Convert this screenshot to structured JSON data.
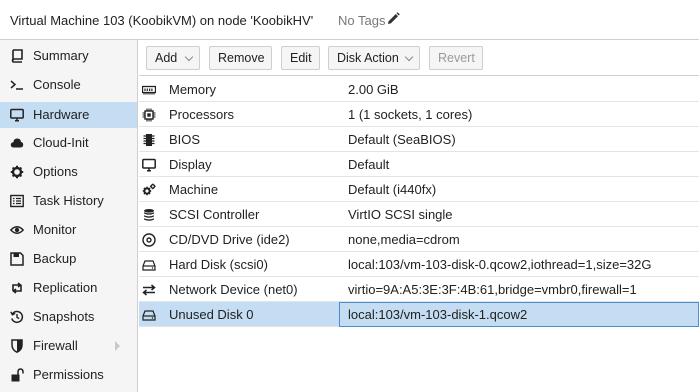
{
  "header": {
    "title": "Virtual Machine 103 (KoobikVM) on node 'KoobikHV'",
    "tags": "No Tags",
    "edit_icon": "pencil-icon"
  },
  "sidebar": {
    "items": [
      {
        "label": "Summary",
        "icon": "book-icon"
      },
      {
        "label": "Console",
        "icon": "terminal-icon"
      },
      {
        "label": "Hardware",
        "icon": "monitor-icon",
        "active": true
      },
      {
        "label": "Cloud-Init",
        "icon": "cloud-icon"
      },
      {
        "label": "Options",
        "icon": "gear-icon"
      },
      {
        "label": "Task History",
        "icon": "list-icon"
      },
      {
        "label": "Monitor",
        "icon": "eye-icon"
      },
      {
        "label": "Backup",
        "icon": "floppy-icon"
      },
      {
        "label": "Replication",
        "icon": "retweet-icon"
      },
      {
        "label": "Snapshots",
        "icon": "history-icon"
      },
      {
        "label": "Firewall",
        "icon": "shield-icon",
        "expandable": true
      },
      {
        "label": "Permissions",
        "icon": "unlock-icon"
      }
    ]
  },
  "toolbar": {
    "add": "Add",
    "remove": "Remove",
    "edit": "Edit",
    "disk_action": "Disk Action",
    "revert": "Revert"
  },
  "hardware": {
    "rows": [
      {
        "key": "Memory",
        "value": "2.00 GiB",
        "icon": "memory-icon"
      },
      {
        "key": "Processors",
        "value": "1 (1 sockets, 1 cores)",
        "icon": "cpu-icon"
      },
      {
        "key": "BIOS",
        "value": "Default (SeaBIOS)",
        "icon": "chip-icon"
      },
      {
        "key": "Display",
        "value": "Default",
        "icon": "desktop-icon"
      },
      {
        "key": "Machine",
        "value": "Default (i440fx)",
        "icon": "cogs-icon"
      },
      {
        "key": "SCSI Controller",
        "value": "VirtIO SCSI single",
        "icon": "database-icon"
      },
      {
        "key": "CD/DVD Drive (ide2)",
        "value": "none,media=cdrom",
        "icon": "cdrom-icon"
      },
      {
        "key": "Hard Disk (scsi0)",
        "value": "local:103/vm-103-disk-0.qcow2,iothread=1,size=32G",
        "icon": "hdd-icon"
      },
      {
        "key": "Network Device (net0)",
        "value": "virtio=9A:A5:3E:3F:4B:61,bridge=vmbr0,firewall=1",
        "icon": "exchange-icon"
      },
      {
        "key": "Unused Disk 0",
        "value": "local:103/vm-103-disk-1.qcow2",
        "icon": "hdd-icon",
        "selected": true
      }
    ]
  },
  "colors": {
    "selection": "#c4ddf2",
    "focus_border": "#4a8ed0",
    "sidebar_bg": "#f5f5f5"
  }
}
